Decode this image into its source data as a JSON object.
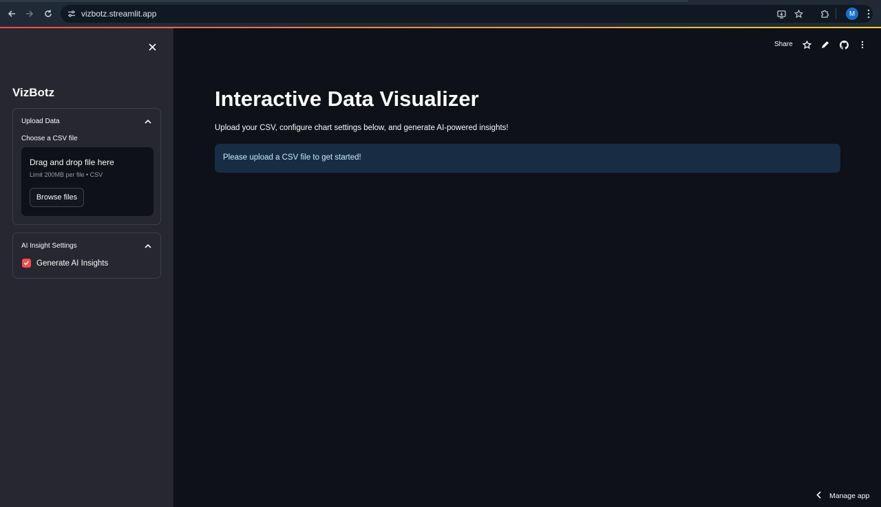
{
  "browser": {
    "url": "vizbotz.streamlit.app",
    "profile_initial": "M",
    "icons": [
      "back-icon",
      "forward-icon",
      "reload-icon",
      "site-info-icon",
      "install-app-icon",
      "bookmark-star-icon",
      "extensions-icon",
      "kebab-menu-icon"
    ]
  },
  "sidebar": {
    "title": "VizBotz",
    "upload_section": {
      "header": "Upload Data",
      "field_label": "Choose a CSV file",
      "drop_title": "Drag and drop file here",
      "drop_limit": "Limit 200MB per file • CSV",
      "browse_label": "Browse files"
    },
    "ai_section": {
      "header": "AI Insight Settings",
      "checkbox_label": "Generate AI Insights",
      "checkbox_checked": true
    }
  },
  "main": {
    "top_actions": {
      "share_label": "Share",
      "icons": [
        "star-icon",
        "edit-pencil-icon",
        "github-icon",
        "more-menu-icon"
      ]
    },
    "title": "Interactive Data Visualizer",
    "subtitle": "Upload your CSV, configure chart settings below, and generate AI-powered insights!",
    "info_message": "Please upload a CSV file to get started!",
    "manage_app_label": "Manage app"
  },
  "colors": {
    "accent": "#ff4b4b",
    "background": "#0e1117",
    "sidebar": "#262730",
    "info_bg": "#172d43",
    "info_text": "#c7ebff"
  }
}
